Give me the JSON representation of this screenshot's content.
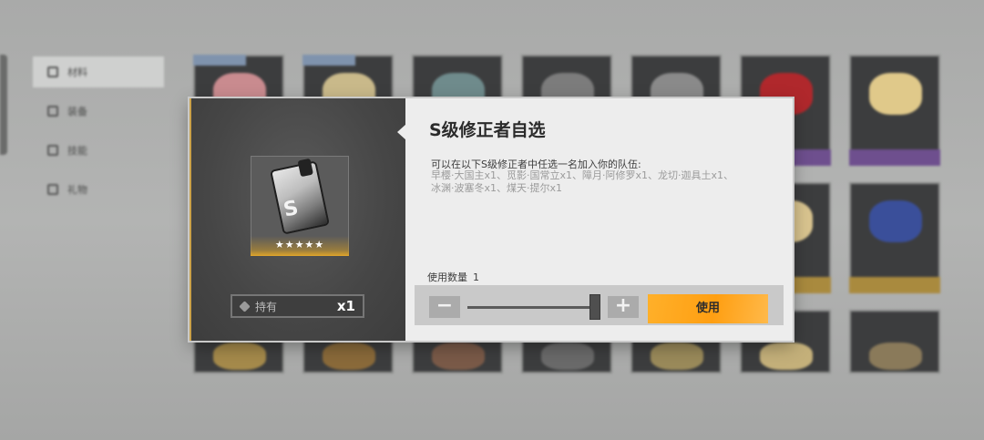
{
  "background": {
    "nav_items": [
      "材料",
      "装备",
      "技能",
      "礼物"
    ]
  },
  "dialog": {
    "title": "S级修正者自选",
    "description_intro": "可以在以下S级修正者中任选一名加入你的队伍:",
    "description_lines": [
      "早樱·大国主x1、觅影·国常立x1、障月·阿修罗x1、龙切·迦具土x1、",
      "冰渊·波塞冬x1、煤天·提尔x1"
    ],
    "quantity_label": "使用数量",
    "quantity_value": "1",
    "use_button": "使用",
    "minus_symbol": "−",
    "plus_symbol": "+",
    "held_label": "持有",
    "held_count": "x1",
    "item_stars": "★★★★★",
    "item_letter": "S"
  },
  "colors": {
    "accent": "#ffa31a",
    "panel_light": "#ededed",
    "panel_dark": "#464646"
  }
}
